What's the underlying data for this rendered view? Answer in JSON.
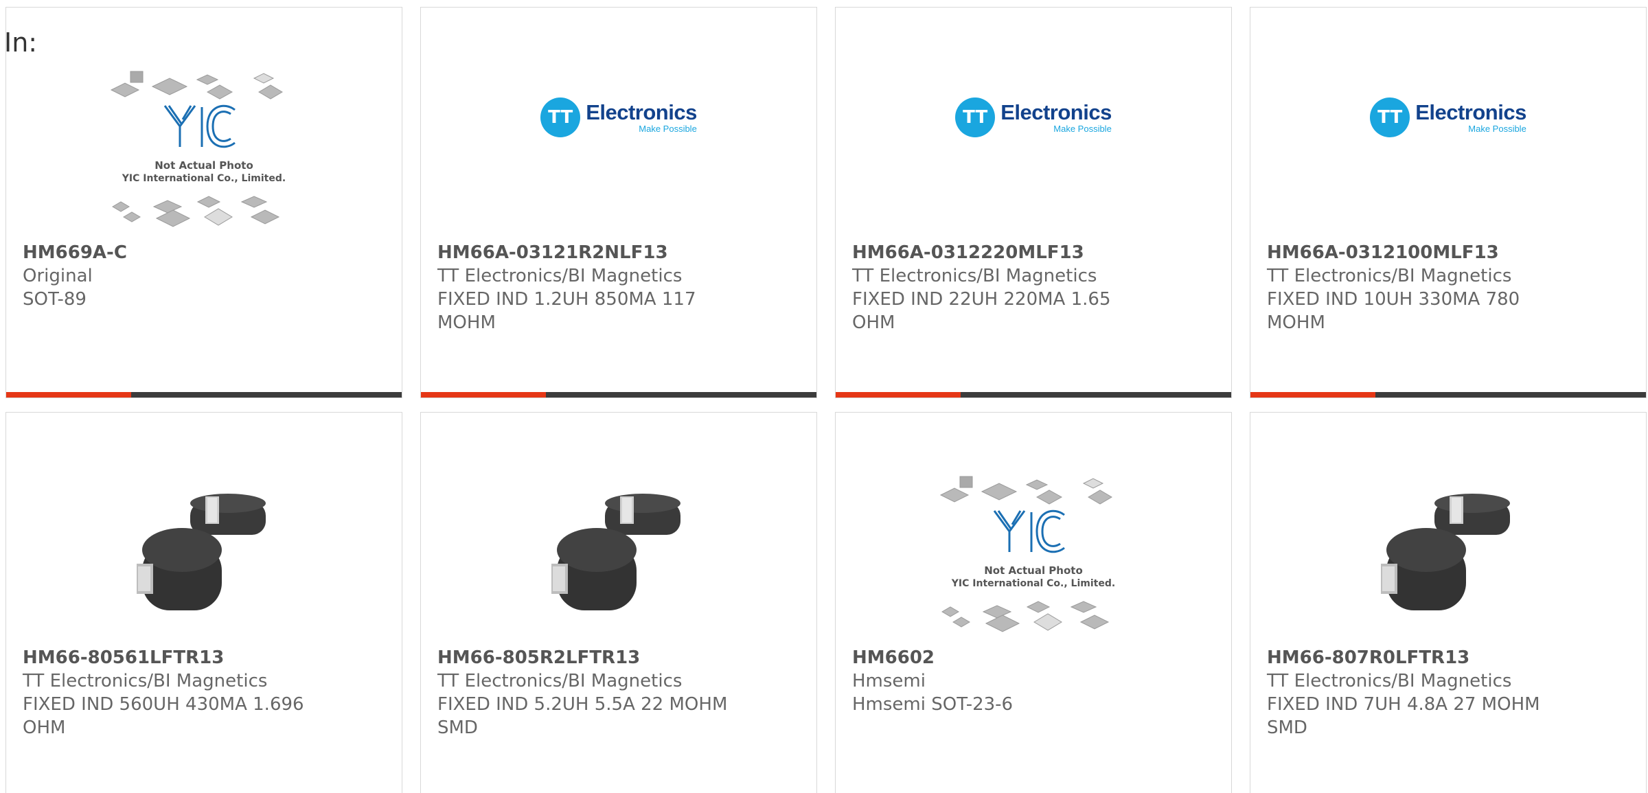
{
  "filter_label": "In:",
  "products": [
    {
      "part": "HM669A-C",
      "maker": "Original",
      "desc": "SOT-89",
      "image": "yic-placeholder-photo",
      "caption_line1": "Not Actual Photo",
      "caption_line2": "YIC International Co., Limited."
    },
    {
      "part": "HM66A-03121R2NLF13",
      "maker": "TT Electronics/BI Magnetics",
      "desc": "FIXED IND 1.2UH 850MA 117 MOHM",
      "image": "tt-electronics-logo",
      "logo_text": "Electronics",
      "logo_tagline": "Make Possible",
      "logo_mark": "TT"
    },
    {
      "part": "HM66A-0312220MLF13",
      "maker": "TT Electronics/BI Magnetics",
      "desc": "FIXED IND 22UH 220MA 1.65 OHM",
      "image": "tt-electronics-logo",
      "logo_text": "Electronics",
      "logo_tagline": "Make Possible",
      "logo_mark": "TT"
    },
    {
      "part": "HM66A-0312100MLF13",
      "maker": "TT Electronics/BI Magnetics",
      "desc": "FIXED IND 10UH 330MA 780 MOHM",
      "image": "tt-electronics-logo",
      "logo_text": "Electronics",
      "logo_tagline": "Make Possible",
      "logo_mark": "TT"
    },
    {
      "part": "HM66-80561LFTR13",
      "maker": "TT Electronics/BI Magnetics",
      "desc": "FIXED IND 560UH 430MA 1.696 OHM",
      "image": "inductor-photo"
    },
    {
      "part": "HM66-805R2LFTR13",
      "maker": "TT Electronics/BI Magnetics",
      "desc": "FIXED IND 5.2UH 5.5A 22 MOHM SMD",
      "image": "inductor-photo"
    },
    {
      "part": "HM6602",
      "maker": "Hmsemi",
      "desc": "Hmsemi SOT-23-6",
      "image": "yic-placeholder-photo",
      "caption_line1": "Not Actual Photo",
      "caption_line2": "YIC International Co., Limited."
    },
    {
      "part": "HM66-807R0LFTR13",
      "maker": "TT Electronics/BI Magnetics",
      "desc": "FIXED IND 7UH 4.8A 27 MOHM SMD",
      "image": "inductor-photo"
    }
  ],
  "colors": {
    "accent_bar": "#e53716",
    "bar": "#3c3c3c",
    "tt_blue": "#1aa6df",
    "tt_navy": "#12428c",
    "yic_blue": "#1b6fb3"
  }
}
